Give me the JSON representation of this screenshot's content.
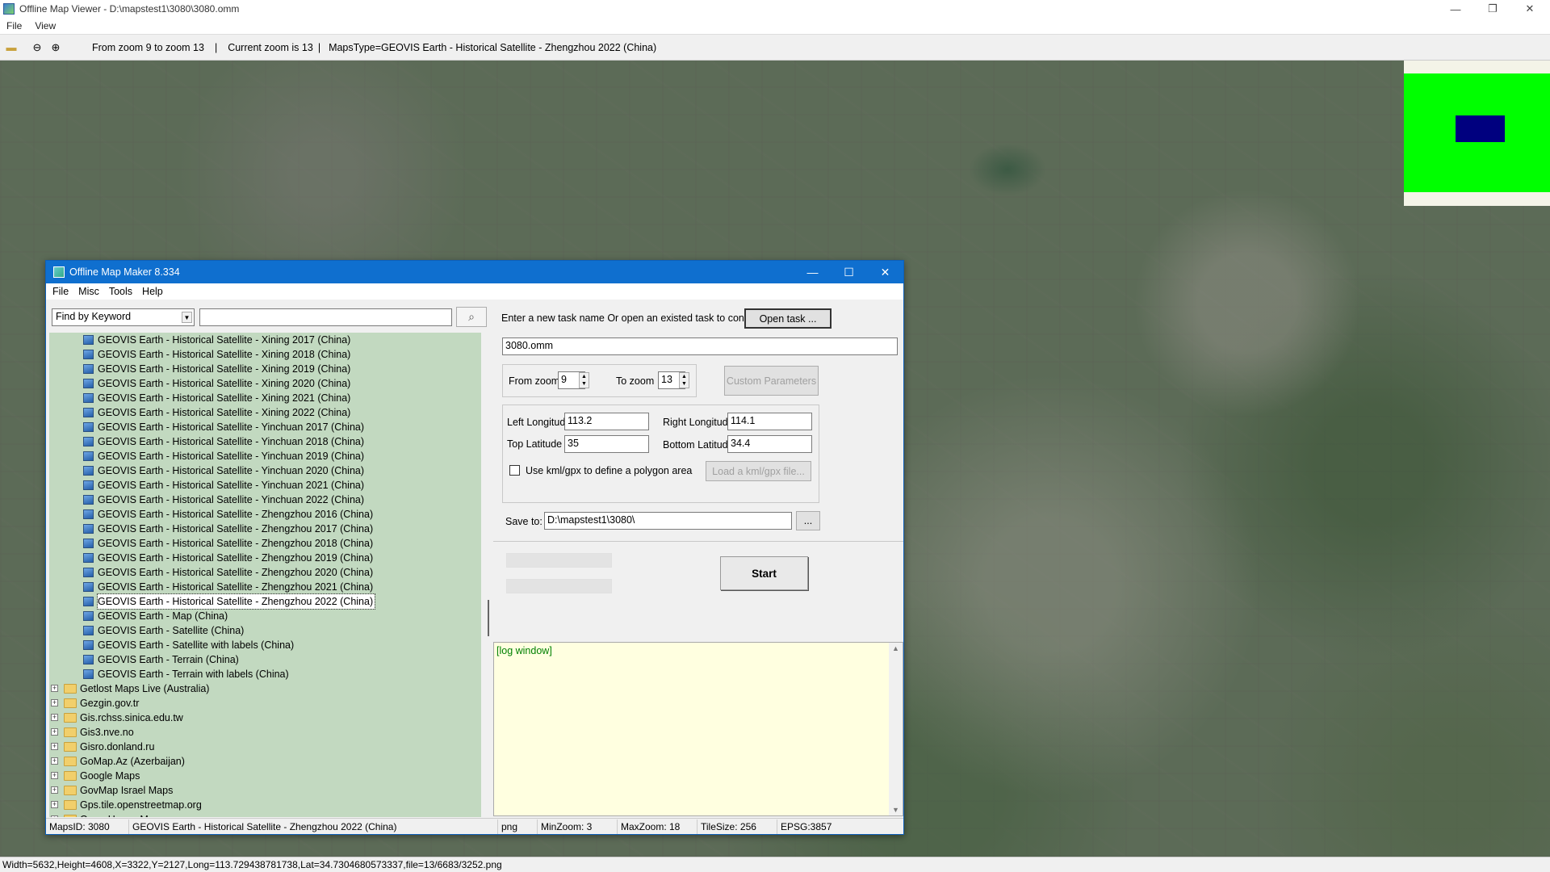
{
  "window": {
    "title": "Offline Map Viewer - D:\\mapstest1\\3080\\3080.omm",
    "minimize": "—",
    "maximize": "❐",
    "close": "✕"
  },
  "menu": [
    "File",
    "View"
  ],
  "toolbar": {
    "zoom_range": "From zoom 9 to zoom 13",
    "sep1": "|",
    "current_zoom": "Current zoom is 13",
    "sep2": "|",
    "maps_type": "MapsType=GEOVIS Earth - Historical Satellite - Zhengzhou 2022 (China)"
  },
  "status_line": "Width=5632,Height=4608,X=3322,Y=2127,Long=113.729438781738,Lat=34.7304680573337,file=13/6683/3252.png",
  "dialog": {
    "title": "Offline Map Maker 8.334",
    "minimize": "—",
    "maximize": "☐",
    "close": "✕",
    "menu": [
      "File",
      "Misc",
      "Tools",
      "Help"
    ],
    "find_mode": "Find by Keyword",
    "search_value": "",
    "tree_items": [
      "GEOVIS Earth - Historical Satellite - Xining 2017 (China)",
      "GEOVIS Earth - Historical Satellite - Xining 2018 (China)",
      "GEOVIS Earth - Historical Satellite - Xining 2019 (China)",
      "GEOVIS Earth - Historical Satellite - Xining 2020 (China)",
      "GEOVIS Earth - Historical Satellite - Xining 2021 (China)",
      "GEOVIS Earth - Historical Satellite - Xining 2022 (China)",
      "GEOVIS Earth - Historical Satellite - Yinchuan 2017 (China)",
      "GEOVIS Earth - Historical Satellite - Yinchuan 2018 (China)",
      "GEOVIS Earth - Historical Satellite - Yinchuan 2019 (China)",
      "GEOVIS Earth - Historical Satellite - Yinchuan 2020 (China)",
      "GEOVIS Earth - Historical Satellite - Yinchuan 2021 (China)",
      "GEOVIS Earth - Historical Satellite - Yinchuan 2022 (China)",
      "GEOVIS Earth - Historical Satellite - Zhengzhou 2016 (China)",
      "GEOVIS Earth - Historical Satellite - Zhengzhou 2017 (China)",
      "GEOVIS Earth - Historical Satellite - Zhengzhou 2018 (China)",
      "GEOVIS Earth - Historical Satellite - Zhengzhou 2019 (China)",
      "GEOVIS Earth - Historical Satellite - Zhengzhou 2020 (China)",
      "GEOVIS Earth - Historical Satellite - Zhengzhou 2021 (China)",
      "GEOVIS Earth - Historical Satellite - Zhengzhou 2022 (China)",
      "GEOVIS Earth - Map (China)",
      "GEOVIS Earth - Satellite (China)",
      "GEOVIS Earth - Satellite with labels (China)",
      "GEOVIS Earth - Terrain (China)",
      "GEOVIS Earth - Terrain with labels (China)"
    ],
    "selected_item": "GEOVIS Earth - Historical Satellite - Zhengzhou 2022 (China)",
    "tree_folders": [
      "Getlost Maps Live (Australia)",
      "Gezgin.gov.tr",
      "Gis.rchss.sinica.edu.tw",
      "Gis3.nve.no",
      "Gisro.donland.ru",
      "GoMap.Az (Azerbaijan)",
      "Google Maps",
      "GovMap Israel Maps",
      "Gps.tile.openstreetmap.org",
      "GreenHouse Maps"
    ],
    "task_prompt": "Enter a new task name Or open an existed task to continue:",
    "open_task": "Open task ...",
    "task_name": "3080.omm",
    "from_zoom_label": "From zoom",
    "from_zoom": "9",
    "to_zoom_label": "To zoom",
    "to_zoom": "13",
    "custom_params": "Custom Parameters",
    "left_lon_label": "Left Longitude",
    "left_lon": "113.2",
    "right_lon_label": "Right Longitude",
    "right_lon": "114.1",
    "top_lat_label": "Top Latitude",
    "top_lat": "35",
    "bottom_lat_label": "Bottom Latitude",
    "bottom_lat": "34.4",
    "kml_label": "Use kml/gpx to define a polygon area",
    "kml_checked": false,
    "load_kml": "Load a kml/gpx file...",
    "save_label": "Save to:",
    "save_path": "D:\\mapstest1\\3080\\",
    "browse": "...",
    "start": "Start",
    "log_title": "[log window]",
    "status": {
      "maps_id": "MapsID: 3080",
      "maps_name": "GEOVIS Earth - Historical Satellite - Zhengzhou 2022 (China)",
      "format": "png",
      "min_zoom": "MinZoom: 3",
      "max_zoom": "MaxZoom: 18",
      "tile_size": "TileSize: 256",
      "epsg": "EPSG:3857"
    }
  },
  "colors": {
    "dialog_title_bg": "#0f6fcf",
    "tree_bg": "#c2d9c0",
    "log_bg": "#ffffe0",
    "log_text": "#008000",
    "minimap_green": "#00ff00",
    "minimap_view": "#00007f"
  },
  "icons": [
    "folder-open-icon",
    "zoom-out-icon",
    "zoom-in-icon",
    "search-icon",
    "map-layer-icon",
    "folder-icon",
    "expand-plus-icon"
  ]
}
